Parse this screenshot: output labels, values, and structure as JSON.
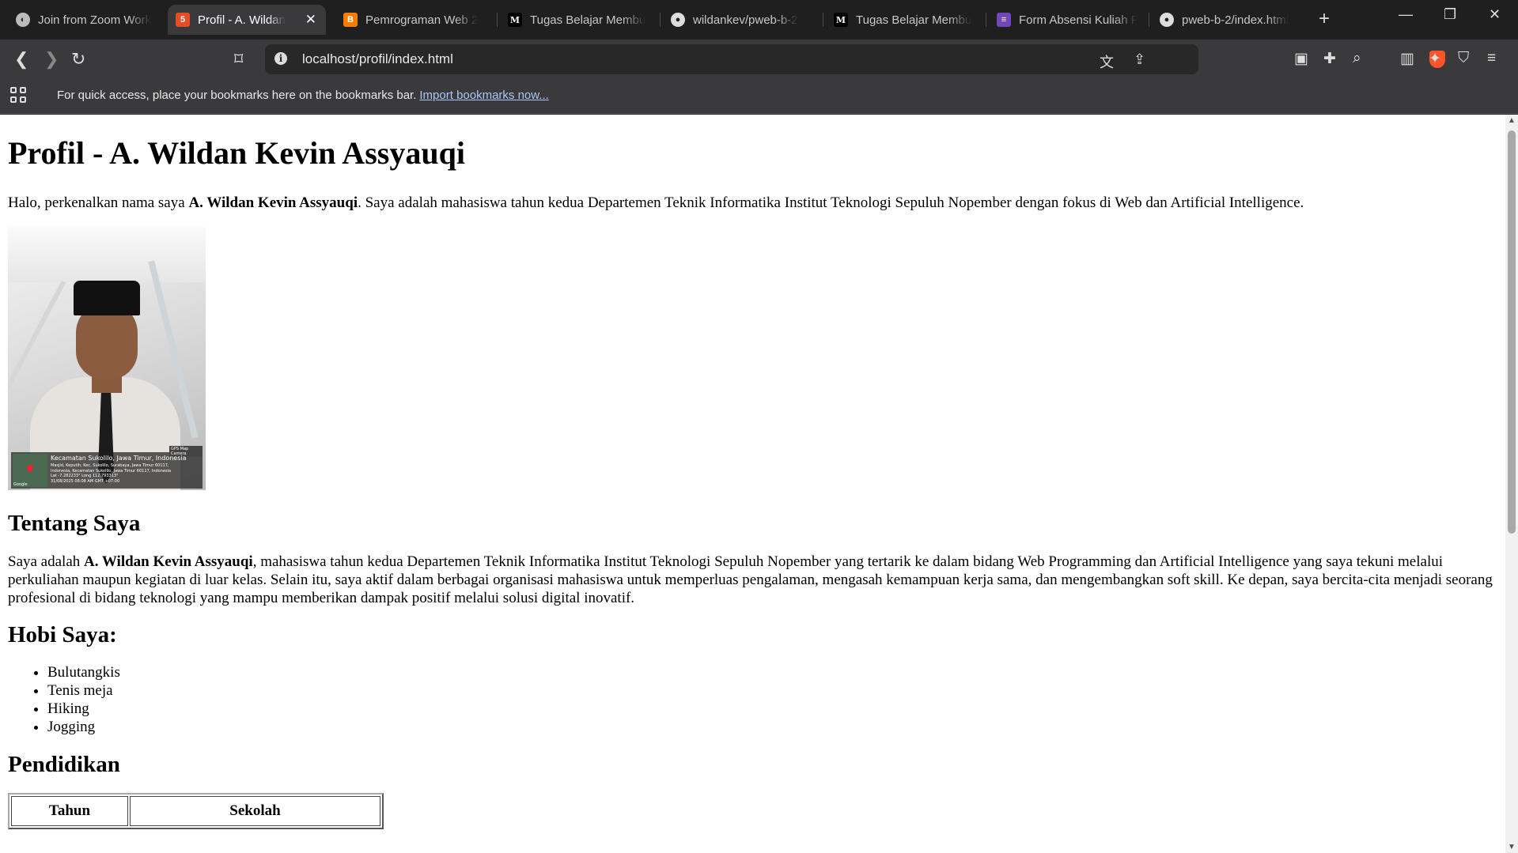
{
  "browser": {
    "tabs": [
      {
        "title": "Join from Zoom Work",
        "icon": "zoom-globe-icon",
        "active": false
      },
      {
        "title": "Profil - A. Wildan",
        "icon": "html5-icon",
        "active": true
      },
      {
        "title": "Pemrograman Web 2",
        "icon": "blogger-icon",
        "active": false
      },
      {
        "title": "Tugas Belajar Membu",
        "icon": "medium-icon",
        "active": false
      },
      {
        "title": "wildankev/pweb-b-2",
        "icon": "github-icon",
        "active": false
      },
      {
        "title": "Tugas Belajar Membu",
        "icon": "medium-icon",
        "active": false
      },
      {
        "title": "Form Absensi Kuliah F",
        "icon": "google-forms-icon",
        "active": false
      },
      {
        "title": "pweb-b-2/index.html",
        "icon": "github-icon",
        "active": false
      }
    ],
    "url": "localhost/profil/index.html",
    "bookmarks_message": "For quick access, place your bookmarks here on the bookmarks bar.",
    "bookmarks_link": "Import bookmarks now...",
    "colors": {
      "tabstrip": "#1f1f1f",
      "toolbar": "#3a3a3c",
      "brave": "#fb542b",
      "link": "#a8c7fa"
    }
  },
  "page": {
    "title": "Profil - A. Wildan Kevin Assyauqi",
    "intro_before": "Halo, perkenalkan nama saya ",
    "intro_name": "A. Wildan Kevin Assyauqi",
    "intro_after": ". Saya adalah mahasiswa tahun kedua Departemen Teknik Informatika Institut Teknologi Sepuluh Nopember dengan fokus di Web dan Artificial Intelligence.",
    "photo_caption": {
      "location": "Kecamatan Sukolilo, Jawa Timur, Indonesia",
      "lines": [
        "Masjid, Keputih, Kec. Sukolilo, Surabaya, Jawa Timur 60117,",
        "Indonesia, Kecamatan Sukolilo, Jawa Timur 60117, Indonesia",
        "Lat -7.282233° Long 112.793313°",
        "31/08/2025 08:08 AM GMT +07:00"
      ],
      "badge": "GPS Map Camera",
      "map_label": "Google"
    },
    "about_heading": "Tentang Saya",
    "about_before": "Saya adalah ",
    "about_name": "A. Wildan Kevin Assyauqi",
    "about_after": ", mahasiswa tahun kedua Departemen Teknik Informatika Institut Teknologi Sepuluh Nopember yang tertarik ke dalam bidang Web Programming dan Artificial Intelligence yang saya tekuni melalui perkuliahan maupun kegiatan di luar kelas. Selain itu, saya aktif dalam berbagai organisasi mahasiswa untuk memperluas pengalaman, mengasah kemampuan kerja sama, dan mengembangkan soft skill. Ke depan, saya bercita-cita menjadi seorang profesional di bidang teknologi yang mampu memberikan dampak positif melalui solusi digital inovatif.",
    "hobby_heading": "Hobi Saya:",
    "hobbies": [
      "Bulutangkis",
      "Tenis meja",
      "Hiking",
      "Jogging"
    ],
    "education_heading": "Pendidikan",
    "table_headers": [
      "Tahun",
      "Sekolah"
    ]
  }
}
